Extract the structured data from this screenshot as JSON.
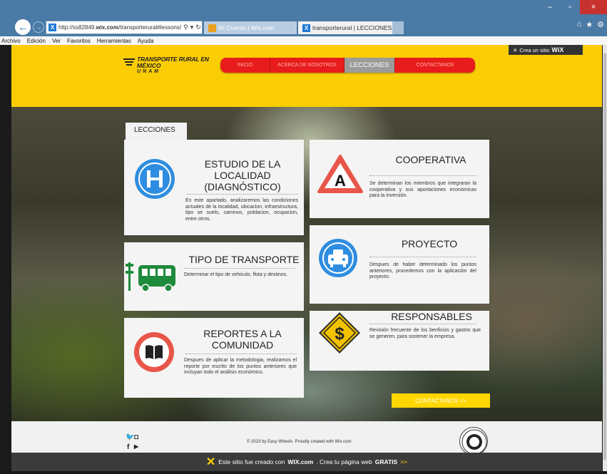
{
  "browser": {
    "address": "http://ss82849.wix.com/transporterural#lessons/",
    "address_host": "wix.com",
    "address_pre": "http://ss82849.",
    "address_post": "/transporterural#lessons/",
    "tabs": [
      {
        "label": "Mi Cuenta | Wix.com"
      },
      {
        "label": "transporterural | LECCIONES"
      }
    ],
    "menu": [
      "Archivo",
      "Edición",
      "Ver",
      "Favoritos",
      "Herramientas",
      "Ayuda"
    ],
    "window_controls": {
      "minimize": "–",
      "maximize": "▫",
      "close": "×"
    }
  },
  "site": {
    "logo": {
      "line1": "TRANSPORTE RURAL EN",
      "line2": "MÉXICO",
      "line3": "UNAM"
    },
    "nav": [
      {
        "label": "INICIO"
      },
      {
        "label": "ACERCA DE NOSOTROS"
      },
      {
        "label": "LECCIONES"
      },
      {
        "label": "CONTACTANOS"
      }
    ],
    "wix_badge": {
      "text": "Crea un sitio",
      "brand": "WiX"
    },
    "section_tab": "LECCIONES",
    "cards": [
      {
        "title": "ESTUDIO DE LA LOCALIDAD (DIAGNÓSTICO)",
        "description": "En este apartado, analizaremos las condiciones actuales de la localidad, ubicacion, infraestructura, tipo se suelo, caminos, poblacion, ocupacion, entre otros.",
        "icon": "hospital-sign-icon"
      },
      {
        "title": "COOPERATIVA",
        "description": "Se determinan los miembros que integraran la cooperativa y sus aportaciones económicas para la inversión.",
        "icon": "warning-triangle-icon"
      },
      {
        "title": "TIPO DE TRANSPORTE",
        "description": "Determinar el tipo de vehiculo, flota y destinos.",
        "icon": "bus-icon"
      },
      {
        "title": "PROYECTO",
        "description": "Despues de haber determinado los puntos anteriores, procedemos con la aplicación del proyecto.",
        "icon": "car-icon"
      },
      {
        "title": "REPORTES A LA COMUNIDAD",
        "description": "Despues de aplicar la metodologia, realizamos el reporte por escrito de los puntos anteriores que incluyan todo el análisis económico.",
        "icon": "book-icon"
      },
      {
        "title": "RESPONSABLES",
        "description": "Revisión frecuente de los benficios y gastos que se generen, para sostener la empresa.",
        "icon": "dollar-sign-icon"
      }
    ],
    "contact_button": "CONTACTANOS >>",
    "footer": {
      "copyright_pre": "© 2023 by Easy Wheels. Proudly created with",
      "copyright_link": "Wix.com",
      "social": {
        "twitter": "🐦",
        "instagram": "◘",
        "facebook": "f",
        "youtube": "▶"
      }
    },
    "wix_banner": {
      "pre": "Este sitio fue creado con",
      "brand": "WIX.com",
      "post": ". Crea tu página web",
      "cta": "GRATIS",
      "arrow": ">>"
    }
  },
  "colors": {
    "header_yellow": "#fbcd05",
    "menu_red": "#e81c1c",
    "menu_active": "#9b9b9b",
    "icon_blue": "#2e8de0",
    "icon_red": "#e8564a",
    "icon_green": "#1e8a3c",
    "sign_yellow": "#f2c200",
    "contact_yellow": "#ffd600"
  }
}
